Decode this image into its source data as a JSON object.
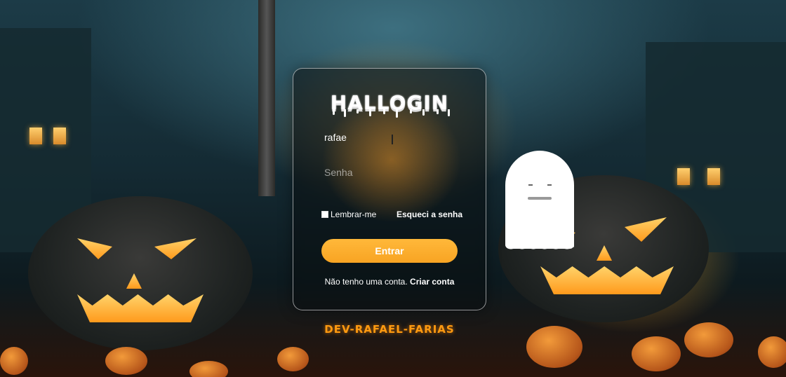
{
  "login": {
    "title": "HALLOGIN",
    "username_value": "rafae",
    "password_placeholder": "Senha",
    "remember_label": "Lembrar-me",
    "forgot_label": "Esqueci a senha",
    "submit_label": "Entrar",
    "no_account_text": "Não tenho uma conta.",
    "create_account_label": "Criar conta"
  },
  "footer": {
    "credit": "DEV-RAFAEL-FARIAS"
  },
  "colors": {
    "accent": "#f8a423",
    "credit": "#ff9a10"
  },
  "icons": {
    "ghost": "ghost-icon"
  }
}
